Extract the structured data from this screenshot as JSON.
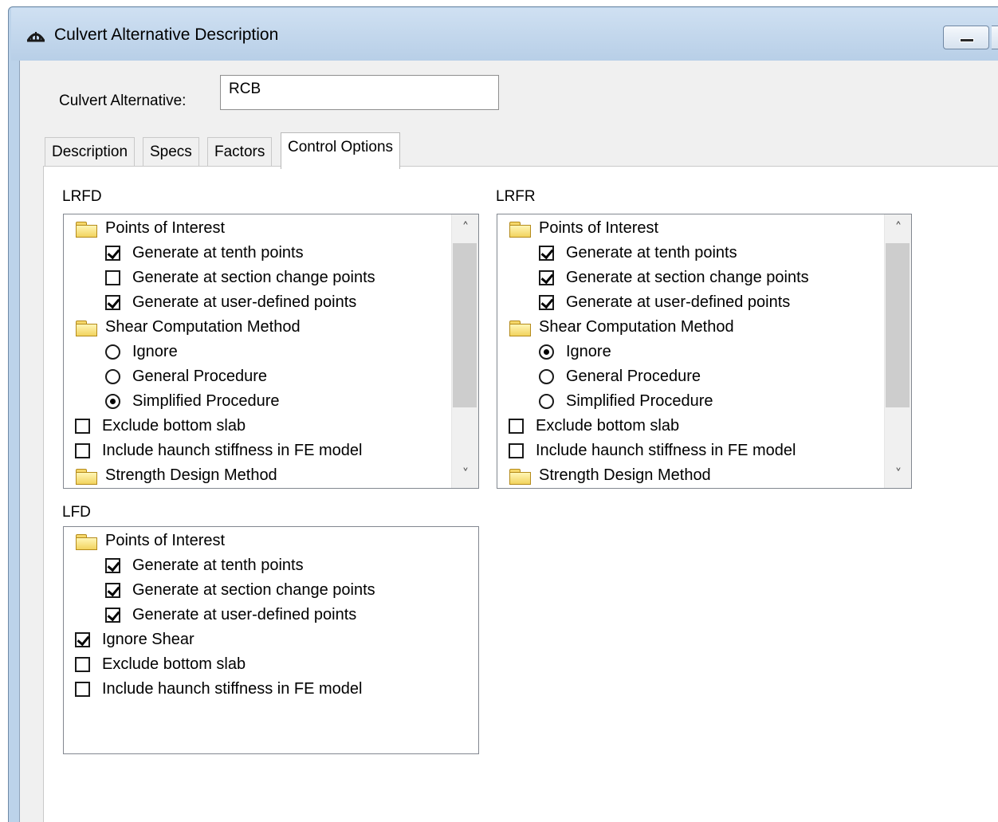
{
  "window": {
    "title": "Culvert Alternative Description"
  },
  "form": {
    "alt_label": "Culvert Alternative:",
    "alt_value": "RCB"
  },
  "tabs": [
    "Description",
    "Specs",
    "Factors",
    "Control Options"
  ],
  "active_tab": "Control Options",
  "lrfd": {
    "label": "LRFD",
    "rows": [
      {
        "kind": "folder",
        "text": "Points of Interest",
        "level": 0
      },
      {
        "kind": "check",
        "text": "Generate at tenth points",
        "checked": true,
        "level": 1
      },
      {
        "kind": "check",
        "text": "Generate at section change points",
        "checked": false,
        "level": 1
      },
      {
        "kind": "check",
        "text": "Generate at user-defined points",
        "checked": true,
        "level": 1
      },
      {
        "kind": "folder",
        "text": "Shear Computation Method",
        "level": 0
      },
      {
        "kind": "radio",
        "text": "Ignore",
        "checked": false,
        "level": 1
      },
      {
        "kind": "radio",
        "text": "General Procedure",
        "checked": false,
        "level": 1
      },
      {
        "kind": "radio",
        "text": "Simplified Procedure",
        "checked": true,
        "level": 1
      },
      {
        "kind": "check",
        "text": "Exclude bottom slab",
        "checked": false,
        "level": 0
      },
      {
        "kind": "check",
        "text": "Include haunch stiffness in FE model",
        "checked": false,
        "level": 0
      },
      {
        "kind": "folder",
        "text": "Strength Design Method",
        "level": 0
      }
    ]
  },
  "lrfr": {
    "label": "LRFR",
    "rows": [
      {
        "kind": "folder",
        "text": "Points of Interest",
        "level": 0
      },
      {
        "kind": "check",
        "text": "Generate at tenth points",
        "checked": true,
        "level": 1
      },
      {
        "kind": "check",
        "text": "Generate at section change points",
        "checked": true,
        "level": 1
      },
      {
        "kind": "check",
        "text": "Generate at user-defined points",
        "checked": true,
        "level": 1
      },
      {
        "kind": "folder",
        "text": "Shear Computation Method",
        "level": 0
      },
      {
        "kind": "radio",
        "text": "Ignore",
        "checked": true,
        "level": 1
      },
      {
        "kind": "radio",
        "text": "General Procedure",
        "checked": false,
        "level": 1
      },
      {
        "kind": "radio",
        "text": "Simplified Procedure",
        "checked": false,
        "level": 1
      },
      {
        "kind": "check",
        "text": "Exclude bottom slab",
        "checked": false,
        "level": 0
      },
      {
        "kind": "check",
        "text": "Include haunch stiffness in FE model",
        "checked": false,
        "level": 0
      },
      {
        "kind": "folder",
        "text": "Strength Design Method",
        "level": 0
      }
    ]
  },
  "lfd": {
    "label": "LFD",
    "rows": [
      {
        "kind": "folder",
        "text": "Points of Interest",
        "level": 0
      },
      {
        "kind": "check",
        "text": "Generate at tenth points",
        "checked": true,
        "level": 1
      },
      {
        "kind": "check",
        "text": "Generate at section change points",
        "checked": true,
        "level": 1
      },
      {
        "kind": "check",
        "text": "Generate at user-defined points",
        "checked": true,
        "level": 1
      },
      {
        "kind": "check",
        "text": "Ignore Shear",
        "checked": true,
        "level": 0
      },
      {
        "kind": "check",
        "text": "Exclude bottom slab",
        "checked": false,
        "level": 0
      },
      {
        "kind": "check",
        "text": "Include haunch stiffness in FE model",
        "checked": false,
        "level": 0
      }
    ]
  }
}
